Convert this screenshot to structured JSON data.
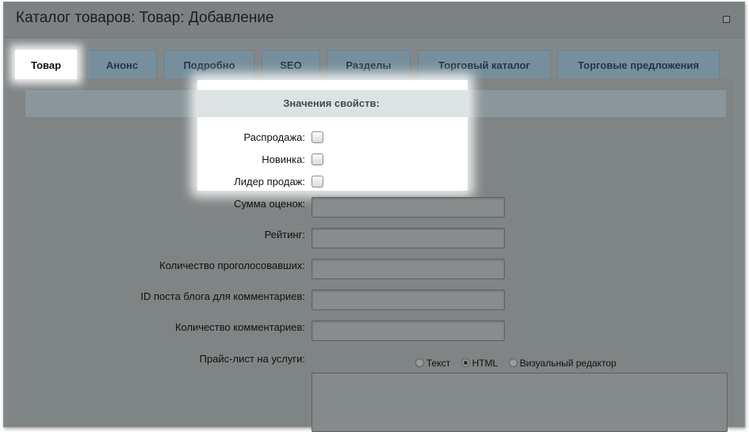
{
  "window": {
    "title": "Каталог товаров: Товар: Добавление"
  },
  "tabs": [
    {
      "label": "Товар",
      "active": true
    },
    {
      "label": "Анонс"
    },
    {
      "label": "Подробно"
    },
    {
      "label": "SEO"
    },
    {
      "label": "Разделы"
    },
    {
      "label": "Торговый каталог"
    },
    {
      "label": "Торговые предложения"
    }
  ],
  "section": {
    "title": "Значения свойств:"
  },
  "checkboxes": [
    {
      "label": "Распродажа:",
      "checked": false
    },
    {
      "label": "Новинка:",
      "checked": false
    },
    {
      "label": "Лидер продаж:",
      "checked": false
    }
  ],
  "fields": [
    {
      "label": "Сумма оценок:",
      "value": ""
    },
    {
      "label": "Рейтинг:",
      "value": ""
    },
    {
      "label": "Количество проголосовавших:",
      "value": ""
    },
    {
      "label": "ID поста блога для комментариев:",
      "value": ""
    },
    {
      "label": "Количество комментариев:",
      "value": ""
    }
  ],
  "price_list": {
    "label": "Прайс-лист на услуги:",
    "modes": [
      {
        "label": "Текст",
        "checked": false
      },
      {
        "label": "HTML",
        "checked": true
      },
      {
        "label": "Визуальный редактор",
        "checked": false
      }
    ],
    "value": ""
  },
  "colors": {
    "accent_tab": "#778f9d",
    "overlay": "#828889"
  }
}
